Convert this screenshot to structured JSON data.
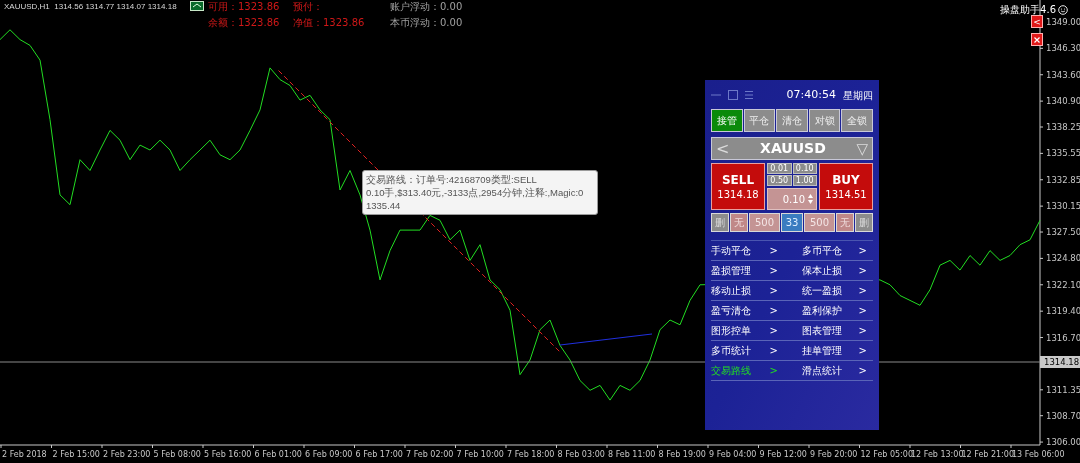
{
  "header": {
    "symbol_info": "XAUUSD,H1  1314.56 1314.77 1314.07 1314.18",
    "account": [
      {
        "text": "可用：1323.86",
        "kind": "funds"
      },
      {
        "text": "预付：",
        "kind": "funds"
      },
      {
        "text": "账户浮动：0.00",
        "kind": "floating"
      },
      {
        "text": "余额：1323.86",
        "kind": "funds"
      },
      {
        "text": "净值：1323.86",
        "kind": "funds"
      },
      {
        "text": "本币浮动：0.00",
        "kind": "floating"
      }
    ]
  },
  "assistant": {
    "title": "操盘助手4.6",
    "collapse": "<"
  },
  "chart": {
    "current_price": "1314.18",
    "tooltip": [
      "交易路线：订单号:42168709类型:SELL",
      "0.10手,$313.40元,-3133点,2954分钟,注释:,Magic:0",
      "1335.44"
    ],
    "x_axis_labels": [
      "2 Feb 2018",
      "2 Feb 15:00",
      "2 Feb 23:00",
      "5 Feb 08:00",
      "5 Feb 16:00",
      "6 Feb 01:00",
      "6 Feb 09:00",
      "6 Feb 17:00",
      "7 Feb 02:00",
      "7 Feb 10:00",
      "7 Feb 18:00",
      "8 Feb 03:00",
      "8 Feb 11:00",
      "8 Feb 19:00",
      "9 Feb 04:00",
      "9 Feb 12:00",
      "9 Feb 20:00",
      "12 Feb 05:00",
      "12 Feb 13:00",
      "12 Feb 21:00",
      "13 Feb 06:00"
    ],
    "chart_data": {
      "type": "line",
      "ylim": [
        1305.7,
        1351.25
      ],
      "series": [
        {
          "color": "#22dd22",
          "values": [
            1347.2,
            1348.2,
            1347.2,
            1346.6,
            1345.1,
            1339.0,
            1331.3,
            1330.3,
            1334.9,
            1333.8,
            1335.9,
            1337.9,
            1336.9,
            1334.9,
            1336.4,
            1335.9,
            1336.9,
            1335.9,
            1333.8,
            1334.9,
            1335.9,
            1336.9,
            1335.4,
            1334.9,
            1335.9,
            1337.9,
            1340.0,
            1344.3,
            1343.1,
            1342.5,
            1341.0,
            1341.5,
            1340.0,
            1339.0,
            1331.8,
            1333.8,
            1331.3,
            1327.7,
            1322.6,
            1325.6,
            1327.7,
            null,
            1327.7,
            1329.2,
            1328.7,
            1326.7,
            1327.7,
            1324.6,
            1326.2,
            1322.6,
            1321.6,
            1319.5,
            1312.9,
            1314.4,
            1317.5,
            1318.5,
            1315.9,
            1314.4,
            1312.3,
            1311.3,
            1311.8,
            1310.3,
            1311.8,
            1311.3,
            1312.3,
            1314.4,
            1317.5,
            1318.5,
            1318.0,
            1320.5,
            1322.1,
            null,
            null,
            null,
            null,
            null,
            null,
            null,
            null,
            null,
            null,
            null,
            null,
            null,
            null,
            null,
            null,
            null,
            1322.6,
            1322.1,
            1321.0,
            1320.5,
            1320.0,
            1321.6,
            1324.1,
            1324.6,
            1323.6,
            1325.1,
            1324.1,
            1325.6,
            1324.6,
            1325.1,
            1326.2,
            1326.7,
            1328.7
          ]
        }
      ],
      "yticks": [
        {
          "value": 1349.0,
          "label": "1349.00"
        },
        {
          "value": 1346.3,
          "label": "1346.30"
        },
        {
          "value": 1343.6,
          "label": "1343.60"
        },
        {
          "value": 1340.9,
          "label": "1340.90"
        },
        {
          "value": 1338.25,
          "label": "1338.25"
        },
        {
          "value": 1335.55,
          "label": "1335.55"
        },
        {
          "value": 1332.85,
          "label": "1332.85"
        },
        {
          "value": 1330.15,
          "label": "1330.15"
        },
        {
          "value": 1327.5,
          "label": "1327.50"
        },
        {
          "value": 1324.8,
          "label": "1324.80"
        },
        {
          "value": 1322.1,
          "label": "1322.10"
        },
        {
          "value": 1319.4,
          "label": "1319.40"
        },
        {
          "value": 1316.7,
          "label": "1316.70"
        },
        {
          "value": 1311.35,
          "label": "1311.35"
        },
        {
          "value": 1308.7,
          "label": "1308.70"
        },
        {
          "value": 1306.0,
          "label": "1306.00"
        }
      ]
    }
  },
  "panel": {
    "time": "07:40:54",
    "weekday": "星期四",
    "tabs": [
      {
        "label": "接管",
        "selected": true
      },
      {
        "label": "平仓",
        "selected": false
      },
      {
        "label": "清仓",
        "selected": false
      },
      {
        "label": "对锁",
        "selected": false
      },
      {
        "label": "全锁",
        "selected": false
      }
    ],
    "symbol": {
      "prev": "<",
      "name": "XAUUSD",
      "dropdown": "▽"
    },
    "sell": {
      "label": "SELL",
      "price": "1314.18"
    },
    "buy": {
      "label": "BUY",
      "price": "1314.51"
    },
    "lots": [
      "0.01",
      "0.10",
      "0.50",
      "1.00"
    ],
    "lot_value": "0.10",
    "order_row": [
      {
        "text": "删",
        "kind": "delete"
      },
      {
        "text": "无",
        "kind": "label"
      },
      {
        "text": "500",
        "kind": "value"
      },
      {
        "text": "33",
        "kind": "count"
      },
      {
        "text": "500",
        "kind": "value"
      },
      {
        "text": "无",
        "kind": "label"
      },
      {
        "text": "删",
        "kind": "delete"
      }
    ],
    "menu": [
      {
        "label": "手动平仓",
        "arrow": ">",
        "selected": false
      },
      {
        "label": "多币平仓",
        "arrow": ">",
        "selected": false
      },
      {
        "label": "盈损管理",
        "arrow": ">",
        "selected": false
      },
      {
        "label": "保本止损",
        "arrow": ">",
        "selected": false
      },
      {
        "label": "移动止损",
        "arrow": ">",
        "selected": false
      },
      {
        "label": "统一盈损",
        "arrow": ">",
        "selected": false
      },
      {
        "label": "盈亏清仓",
        "arrow": ">",
        "selected": false
      },
      {
        "label": "盈利保护",
        "arrow": ">",
        "selected": false
      },
      {
        "label": "图形控单",
        "arrow": ">",
        "selected": false
      },
      {
        "label": "图表管理",
        "arrow": ">",
        "selected": false
      },
      {
        "label": "多币统计",
        "arrow": ">",
        "selected": false
      },
      {
        "label": "挂单管理",
        "arrow": ">",
        "selected": false
      },
      {
        "label": "交易路线",
        "arrow": ">",
        "selected": true
      },
      {
        "label": "滑点统计",
        "arrow": ">",
        "selected": false
      }
    ]
  }
}
